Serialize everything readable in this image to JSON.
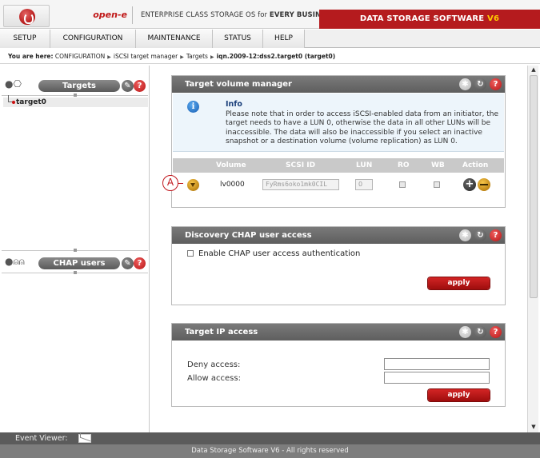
{
  "header": {
    "brand": "open-e",
    "tagline_prefix": "ENTERPRISE CLASS STORAGE OS for ",
    "tagline_bold": "EVERY BUSINESS",
    "product": "DATA STORAGE SOFTWARE ",
    "product_version": "V6"
  },
  "menu": [
    "SETUP",
    "CONFIGURATION",
    "MAINTENANCE",
    "STATUS",
    "HELP"
  ],
  "breadcrumb": {
    "label": "You are here:",
    "items": [
      "CONFIGURATION",
      "iSCSI target manager",
      "Targets"
    ],
    "current": "iqn.2009-12:dss2.target0 (target0)"
  },
  "left": {
    "targets_title": "Targets",
    "tree_item": "target0",
    "chap_title": "CHAP users"
  },
  "target_volume_manager": {
    "title": "Target volume manager",
    "info_title": "Info",
    "info_text": "Please note that in order to access iSCSI-enabled data from an initiator, the target needs to have a LUN 0, otherwise the data in all other LUNs will be inaccessible. The data will also be inaccessible if you select an inactive snapshot or a destination volume (volume replication) as LUN 0.",
    "columns": [
      "Volume",
      "SCSI ID",
      "LUN",
      "RO",
      "WB",
      "Action"
    ],
    "row": {
      "volume": "lv0000",
      "scsi_id": "FyRms6oko1mk0CIL",
      "lun": "0"
    },
    "callout": "A"
  },
  "discovery_chap": {
    "title": "Discovery CHAP user access",
    "checkbox_label": "Enable CHAP user access authentication",
    "apply": "apply"
  },
  "target_ip": {
    "title": "Target IP access",
    "deny_label": "Deny access:",
    "allow_label": "Allow access:",
    "deny_value": "",
    "allow_value": "",
    "apply": "apply"
  },
  "footer": {
    "event_viewer": "Event Viewer:",
    "copyright": "Data Storage Software V6 - All rights reserved"
  },
  "icons": {
    "settings": "gear-icon",
    "refresh": "refresh-icon",
    "help": "help-icon",
    "tools": "wrench-icon",
    "info": "info-icon",
    "mail": "mail-icon"
  },
  "colors": {
    "brand_red": "#b51b1e",
    "version_yellow": "#ffcc00",
    "panel_header": "#6b6b6b",
    "info_bg": "#edf5fb"
  }
}
